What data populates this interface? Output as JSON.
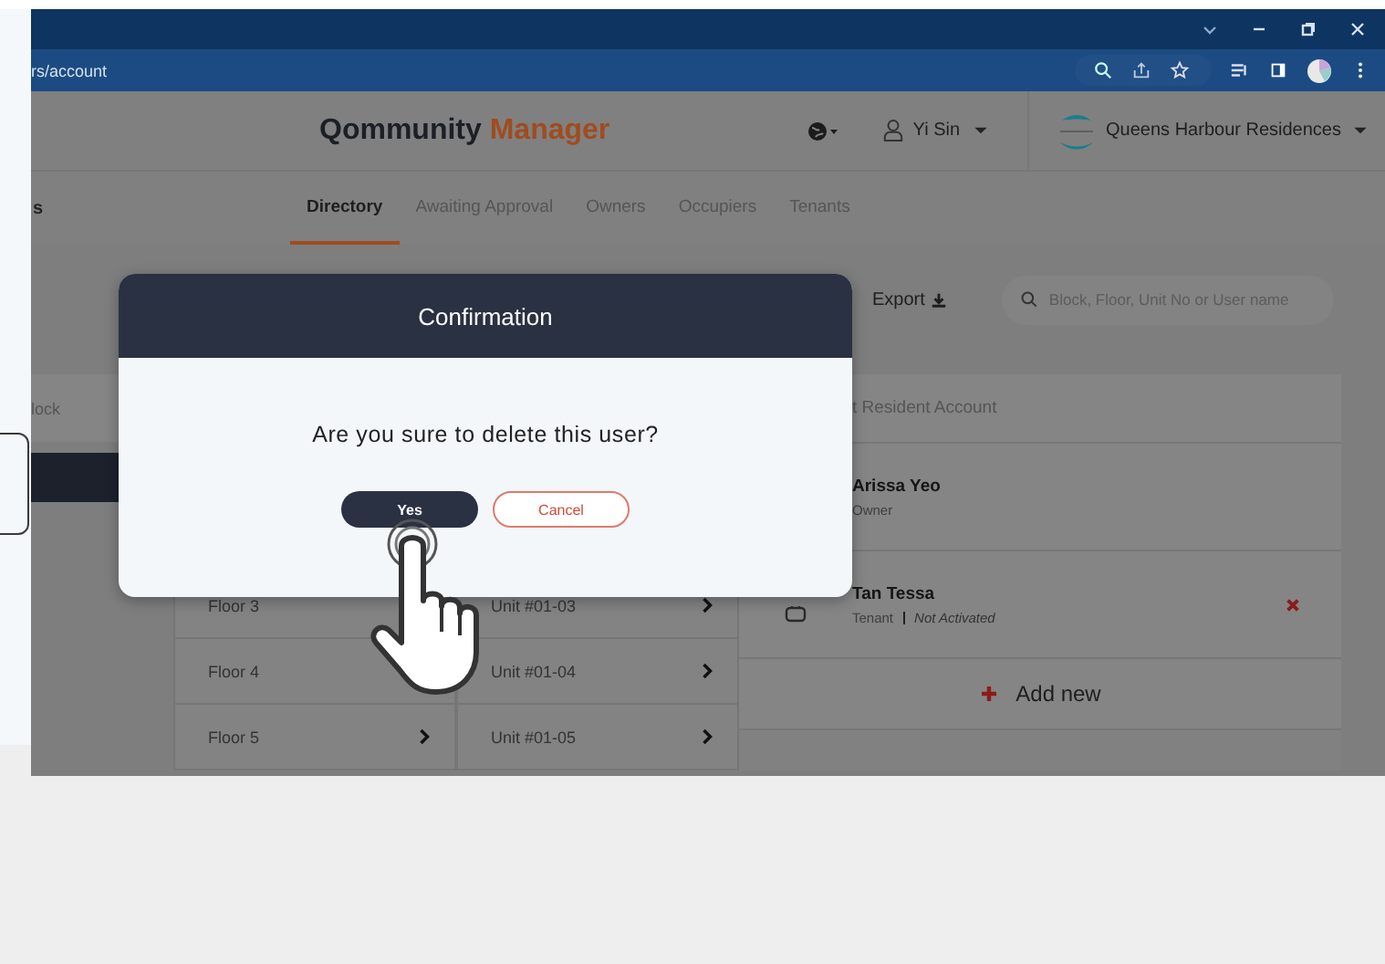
{
  "browser": {
    "url": "rs/account"
  },
  "header": {
    "logo": "Qommunity",
    "logo_accent": "Manager",
    "user": "Yi Sin",
    "property": "Queens Harbour Residences"
  },
  "sidebar_title": "s",
  "tabs": [
    {
      "label": "Directory",
      "selected": true
    },
    {
      "label": "Awaiting Approval",
      "selected": false
    },
    {
      "label": "Owners",
      "selected": false
    },
    {
      "label": "Occupiers",
      "selected": false
    },
    {
      "label": "Tenants",
      "selected": false
    }
  ],
  "toolbar": {
    "export": "Export",
    "search": {
      "placeholder": "Block, Floor, Unit No or User name"
    }
  },
  "block_column": {
    "heading": "lock"
  },
  "floors": [
    {
      "label": "Floor 3"
    },
    {
      "label": "Floor 4"
    },
    {
      "label": "Floor 5",
      "chevron": true
    }
  ],
  "units": [
    {
      "label": "Unit #01-03"
    },
    {
      "label": "Unit #01-04"
    },
    {
      "label": "Unit #01-05"
    }
  ],
  "residents": {
    "heading": "t Resident Account",
    "add_new": "Add new",
    "items": [
      {
        "name": "Arissa Yeo",
        "role": "Owner",
        "removable": false
      },
      {
        "name": "Tan Tessa",
        "role": "Tenant",
        "status": "Not Activated",
        "device": true,
        "removable": true
      }
    ]
  },
  "dialog": {
    "title": "Confirmation",
    "message": "Are you sure to delete this user?",
    "confirm": "Yes",
    "cancel": "Cancel"
  }
}
